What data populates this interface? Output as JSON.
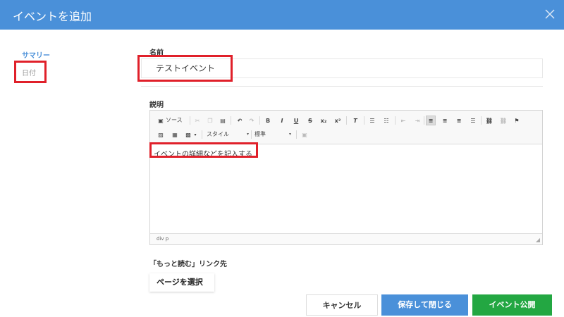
{
  "dialog": {
    "title": "イベントを追加"
  },
  "sidebar": {
    "items": [
      {
        "label": "サマリー"
      },
      {
        "label": "日付"
      }
    ]
  },
  "form": {
    "name_label": "名前",
    "name_value": "テストイベント",
    "description_label": "説明",
    "description_text": "イベントの詳細などを記入する",
    "readmore_label": "「もっと読む」リンク先",
    "page_select_label": "ページを選択"
  },
  "editor": {
    "toolbar": {
      "source_label": "ソース",
      "style_label": "スタイル",
      "format_label": "標準"
    },
    "status_path": "div  p"
  },
  "buttons": {
    "cancel": "キャンセル",
    "save_close": "保存して閉じる",
    "publish": "イベント公開"
  },
  "colors": {
    "header": "#4a90d9",
    "accent": "#4a90d9",
    "publish": "#23a742",
    "highlight": "#e0202a"
  }
}
